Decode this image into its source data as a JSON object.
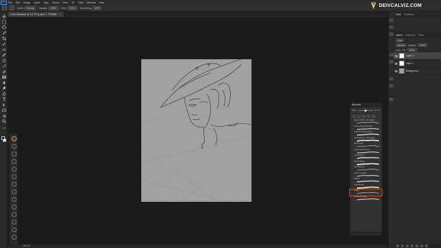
{
  "app": {
    "logo_text": "Ps"
  },
  "brand": {
    "name": "DEIVCALVIZ.COM"
  },
  "menu": [
    "File",
    "Edit",
    "Image",
    "Layer",
    "Type",
    "Select",
    "Filter",
    "3D",
    "View",
    "Window",
    "Help"
  ],
  "options": {
    "mode_label": "Mode:",
    "mode_value": "Normal",
    "opacity_label": "Opacity:",
    "opacity_value": "100%",
    "flow_label": "Flow:",
    "flow_value": "100%",
    "smoothing_label": "Smoothing:",
    "smoothing_value": "10%"
  },
  "document": {
    "tab_title": "Cafe Metacast @ 16.7% (Layer 1, RGB/8)",
    "close": "×",
    "zoom": "16.67%"
  },
  "right_panels": {
    "tabs": [
      "Color",
      "Swatches"
    ],
    "sub_tabs": [
      "Layers",
      "Channels",
      "Paths"
    ],
    "kind_label": "Kind",
    "blend_value": "Normal",
    "opacity_label": "Opacity:",
    "opacity_value": "100%",
    "lock_label": "Lock:",
    "fill_label": "Fill:",
    "fill_value": "100%",
    "layers": [
      {
        "name": "Layer 3",
        "selected": true,
        "thumb": "white"
      },
      {
        "name": "Layer 1",
        "selected": false,
        "thumb": "white"
      },
      {
        "name": "Background",
        "selected": false,
        "thumb": "gray"
      }
    ]
  },
  "brushes_panel": {
    "title": "Brushes",
    "size_label": "Size:",
    "size_value": "30 px",
    "items": [
      "Kyle's Inkbox - Dry Media",
      "Kyle's Spatter Brushes",
      "Kyle's Screentones 38",
      "Kyle's Inkbox - Wet Media",
      "Round Soft",
      "Kyle's Drawing Pen",
      "Ink Sketch 2",
      "Pencil Deluxe",
      "Soft Airbrush",
      "Kyle's Gouache",
      "Sketch",
      "Hard Round",
      "Eraser",
      "Charcoal Pencil"
    ],
    "selected_index": 12
  }
}
